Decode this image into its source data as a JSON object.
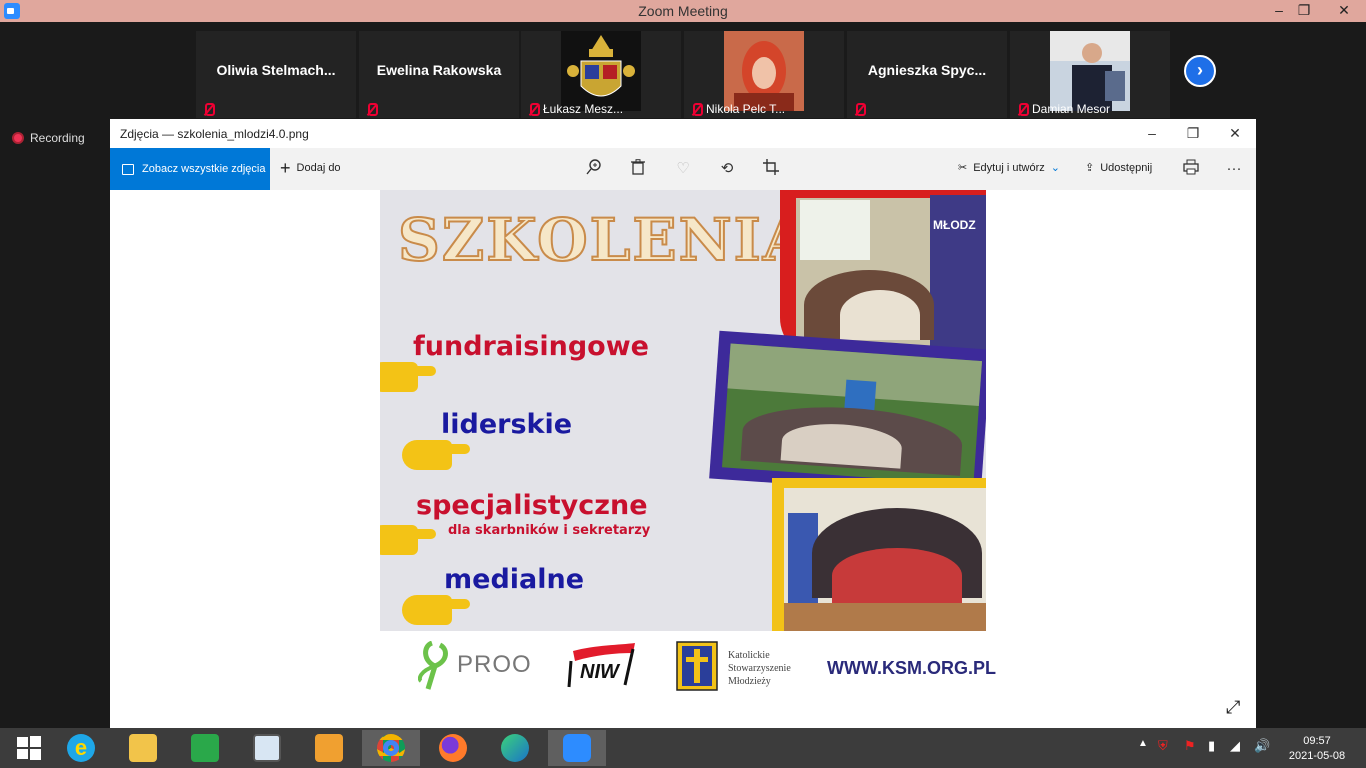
{
  "zoom": {
    "title": "Zoom Meeting",
    "window_buttons": {
      "minimize": "‒",
      "restore": "❐",
      "close": "✕"
    },
    "recording_label": "Recording"
  },
  "participants": [
    {
      "name": "Oliwia  Stelmach...",
      "footer_name": ""
    },
    {
      "name": "Ewelina Rakowska",
      "footer_name": ""
    },
    {
      "name": "",
      "footer_name": "Łukasz Mesz..."
    },
    {
      "name": "",
      "footer_name": "Nikola Pelc T..."
    },
    {
      "name": "Agnieszka  Spyc...",
      "footer_name": ""
    },
    {
      "name": "",
      "footer_name": "Damian Mesor"
    }
  ],
  "photos_app": {
    "title": "Zdjęcia — szkolenia_mlodzi4.0.png",
    "see_all": "Zobacz wszystkie zdjęcia",
    "add_to": "Dodaj do",
    "edit_create": "Edytuj i utwórz",
    "share": "Udostępnij",
    "more": "···"
  },
  "image": {
    "headline": "SZKOLENIA",
    "items": [
      {
        "text": "fundraisingowe",
        "color": "#c8102e"
      },
      {
        "text": "liderskie",
        "color": "#1a1aa0"
      },
      {
        "text": "specjalistyczne",
        "color": "#c8102e"
      },
      {
        "text": "dla skarbników i sekretarzy",
        "color": "#c8102e"
      },
      {
        "text": "medialne",
        "color": "#1a1aa0"
      }
    ],
    "sign_text": "MŁODZ",
    "logos": {
      "proo": "PROO",
      "niw": "NIW",
      "ksm_line1": "Katolickie",
      "ksm_line2": "Stowarzyszenie",
      "ksm_line3": "Młodzieży",
      "website": "WWW.KSM.ORG.PL"
    }
  },
  "taskbar": {
    "time": "09:57",
    "date": "2021-05-08"
  }
}
